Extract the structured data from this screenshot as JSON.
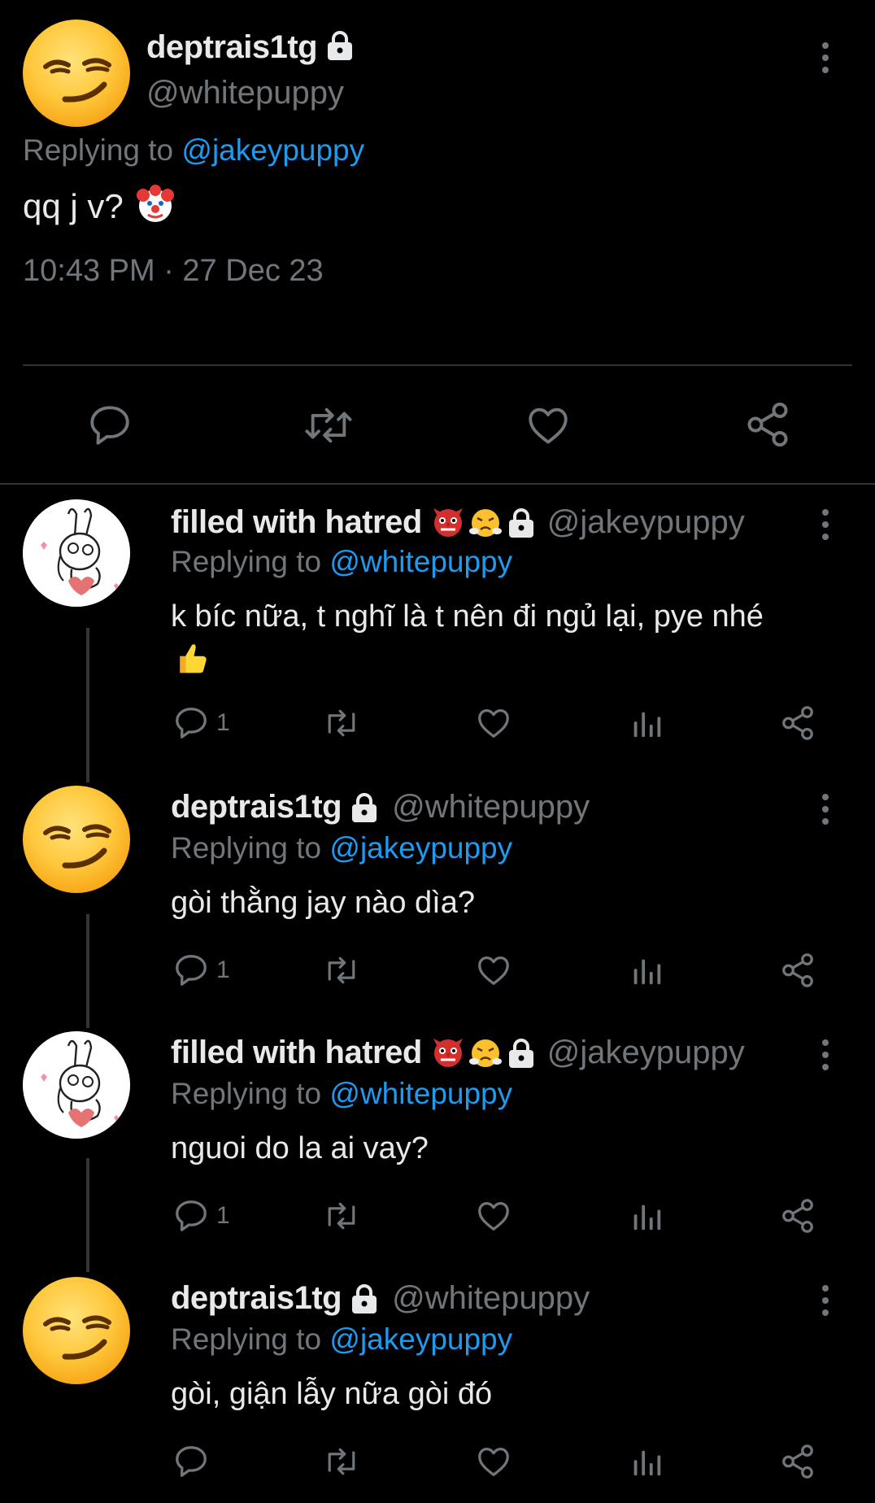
{
  "main_tweet": {
    "display_name": "deptrais1tg",
    "handle": "@whitepuppy",
    "replying_label": "Replying to",
    "replying_to": "@jakeypuppy",
    "text": "qq j v?",
    "emoji": "clown-face",
    "timestamp": "10:43 PM · 27 Dec 23"
  },
  "replies": [
    {
      "display_name": "filled with hatred",
      "emoji_1": "goblin-mask",
      "emoji_2": "steam-from-nose",
      "handle": "@jakeypuppy",
      "replying_label": "Replying to",
      "replying_to": "@whitepuppy",
      "text": "k bíc nữa, t nghĩ là t nên đi ngủ lại, pye nhé",
      "text_emoji": "thumbs-up",
      "reply_count": "1"
    },
    {
      "display_name": "deptrais1tg",
      "handle": "@whitepuppy",
      "replying_label": "Replying to",
      "replying_to": "@jakeypuppy",
      "text": "gòi thằng jay nào dìa?",
      "reply_count": "1"
    },
    {
      "display_name": "filled with hatred",
      "emoji_1": "goblin-mask",
      "emoji_2": "steam-from-nose",
      "handle": "@jakeypuppy",
      "replying_label": "Replying to",
      "replying_to": "@whitepuppy",
      "text": "nguoi do la ai vay?",
      "reply_count": "1"
    },
    {
      "display_name": "deptrais1tg",
      "handle": "@whitepuppy",
      "replying_label": "Replying to",
      "replying_to": "@jakeypuppy",
      "text": "gòi, giận lẫy nữa gòi đó",
      "reply_count": ""
    }
  ],
  "colors": {
    "background": "#000000",
    "text": "#e7e9ea",
    "muted": "#71767b",
    "link": "#1d9bf0",
    "divider": "#2f3336"
  }
}
